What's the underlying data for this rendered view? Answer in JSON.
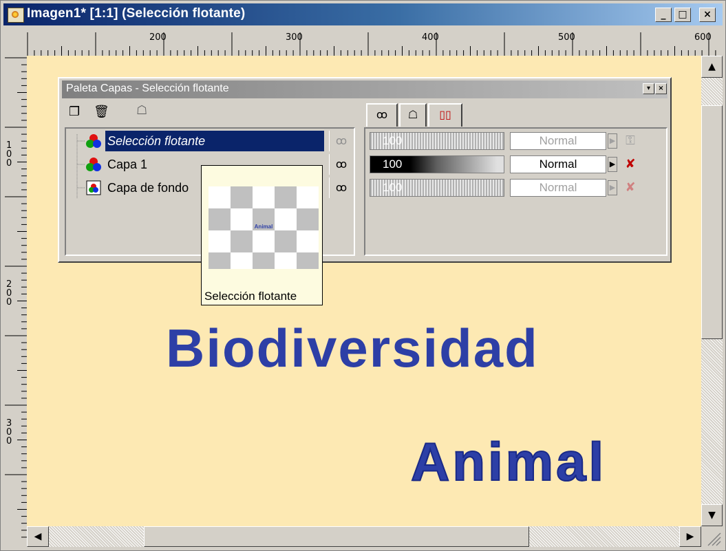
{
  "window": {
    "title": "Imagen1* [1:1] (Selección flotante)",
    "buttons": {
      "minimize": "_",
      "maximize": "□",
      "close": "×"
    }
  },
  "ruler": {
    "horizontal_labels": [
      "200",
      "300",
      "400",
      "500",
      "600"
    ],
    "vertical_labels": [
      [
        "1",
        "0",
        "0"
      ],
      [
        "2",
        "0",
        "0"
      ],
      [
        "3",
        "0",
        "0"
      ]
    ]
  },
  "canvas": {
    "background_color": "#fde9b3",
    "text_color": "#2d3fa6",
    "line1": "Biodiversidad",
    "line2": "Animal"
  },
  "layers_palette": {
    "title": "Paleta Capas - Selección flotante",
    "tool_icons": [
      "new-layer-icon",
      "delete-layer-icon",
      "mask-icon"
    ],
    "tabs": [
      "visibility-tab",
      "mask-tab",
      "group-tab"
    ],
    "layers": [
      {
        "name": "Selección flotante",
        "selected": true,
        "opacity": "100",
        "blend": "Normal",
        "enabled": false,
        "visibility_icon": "glasses-icon"
      },
      {
        "name": "Capa 1",
        "selected": false,
        "opacity": "100",
        "blend": "Normal",
        "enabled": true,
        "visibility_icon": "glasses-icon"
      },
      {
        "name": "Capa de fondo",
        "selected": false,
        "opacity": "100",
        "blend": "Normal",
        "enabled": false,
        "visibility_icon": "glasses-icon"
      }
    ]
  },
  "tooltip": {
    "label": "Selección flotante",
    "thumbnail_text": "Animal"
  }
}
